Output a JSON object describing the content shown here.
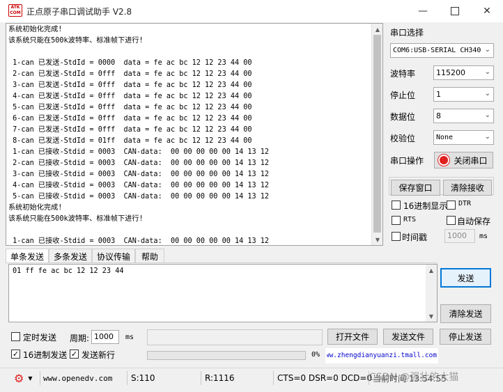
{
  "window": {
    "title": "正点原子串口调试助手 V2.8",
    "logo_text": "ATK\nCOM"
  },
  "receive": {
    "lines": [
      "系统初始化完成!",
      "该系统只能在500k波特率、标准帧下进行!",
      "",
      " 1-can 已发送-StdId = 0000  data = fe ac bc 12 12 23 44 00",
      " 2-can 已发送-StdId = 0fff  data = fe ac bc 12 12 23 44 00",
      " 3-can 已发送-StdId = 0fff  data = fe ac bc 12 12 23 44 00",
      " 4-can 已发送-StdId = 0fff  data = fe ac bc 12 12 23 44 00",
      " 5-can 已发送-StdId = 0fff  data = fe ac bc 12 12 23 44 00",
      " 6-can 已发送-StdId = 0fff  data = fe ac bc 12 12 23 44 00",
      " 7-can 已发送-StdId = 0fff  data = fe ac bc 12 12 23 44 00",
      " 8-can 已发送-StdId = 01ff  data = fe ac bc 12 12 23 44 00",
      " 1-can 已接收-Stdid = 0003  CAN-data:  00 00 00 00 00 14 13 12",
      " 2-can 已接收-Stdid = 0003  CAN-data:  00 00 00 00 00 14 13 12",
      " 3-can 已接收-Stdid = 0003  CAN-data:  00 00 00 00 00 14 13 12",
      " 4-can 已接收-Stdid = 0003  CAN-data:  00 00 00 00 00 14 13 12",
      " 5-can 已接收-Stdid = 0003  CAN-data:  00 00 00 00 00 14 13 12",
      "系统初始化完成!",
      "该系统只能在500k波特率、标准帧下进行!",
      "",
      " 1-can 已接收-Stdid = 0003  CAN-data:  00 00 00 00 00 14 13 12"
    ]
  },
  "settings": {
    "port_label": "串口选择",
    "port_value": "COM6:USB-SERIAL CH340",
    "baud_label": "波特率",
    "baud_value": "115200",
    "stop_label": "停止位",
    "stop_value": "1",
    "data_label": "数据位",
    "data_value": "8",
    "parity_label": "校验位",
    "parity_value": "None",
    "op_label": "串口操作",
    "close_port": "关闭串口",
    "save_window": "保存窗口",
    "clear_recv": "清除接收",
    "hex_display": "16进制显示",
    "dtr": "DTR",
    "rts": "RTS",
    "auto_save": "自动保存",
    "timestamp": "时间戳",
    "timestamp_value": "1000",
    "timestamp_unit": "ms"
  },
  "tabs": [
    "单条发送",
    "多条发送",
    "协议传输",
    "帮助"
  ],
  "send": {
    "text": "01 ff fe ac bc 12 12 23 44",
    "send_button": "发送",
    "clear_send": "清除发送",
    "timed_send": "定时发送",
    "period_label": "周期:",
    "period_value": "1000",
    "period_unit": "ms",
    "open_file": "打开文件",
    "send_file": "发送文件",
    "stop_send": "停止发送",
    "hex_send": "16进制发送",
    "send_newline": "发送新行",
    "progress_text": "0%",
    "progress": 0,
    "shop_link": "www.zhengdianyuanzi.tmall.com"
  },
  "status": {
    "site": "www.openedv.com",
    "sent": "S:110",
    "recv": "R:1116",
    "lines": "CTS=0 DSR=0 DCD=0",
    "time": "当前时间 13:54:55",
    "watermark": "CSDN @强壮的大猫"
  },
  "colors": {
    "close_port_red": "#e02020",
    "link_blue": "#0000cc",
    "focus_blue": "#0078d7"
  }
}
